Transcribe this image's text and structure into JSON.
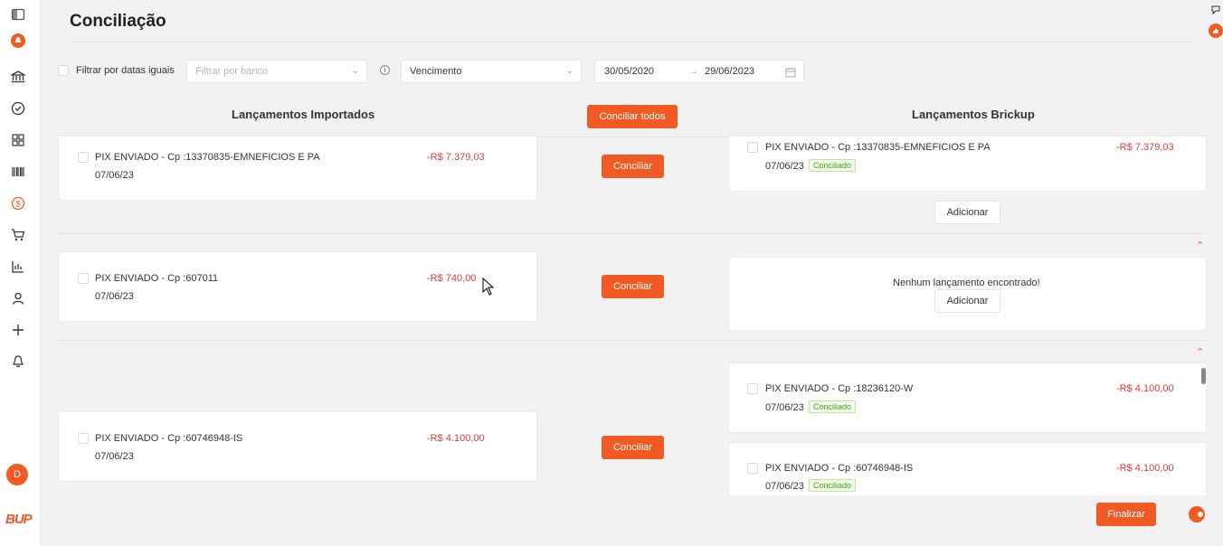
{
  "page": {
    "title": "Conciliação"
  },
  "sidebar": {
    "icons": [
      "sidebar-toggle-icon",
      "notification-badge-icon",
      "bank-icon",
      "check-circle-icon",
      "grid-icon",
      "barcode-icon",
      "dollar-circle-icon",
      "cart-icon",
      "chart-icon",
      "user-icon",
      "plus-icon",
      "bell-icon"
    ],
    "avatar": "D",
    "logo": "BUP"
  },
  "filters": {
    "same_dates_label": "Filtrar por datas iguais",
    "bank_placeholder": "Filtrar por banco",
    "date_type_value": "Vencimento",
    "date_from": "30/05/2020",
    "date_to": "29/06/2023"
  },
  "columns": {
    "imported_title": "Lançamentos Importados",
    "brickup_title": "Lançamentos Brickup",
    "conciliate_all": "Conciliar todos"
  },
  "rows": [
    {
      "imported": {
        "desc": "PIX ENVIADO - Cp :13370835-EMNEFICIOS E PA",
        "date": "07/06/23",
        "amount": "-R$ 7.379,03"
      },
      "action": "Conciliar",
      "brickup": [
        {
          "desc": "PIX ENVIADO - Cp :13370835-EMNEFICIOS E PA",
          "date": "07/06/23",
          "amount": "-R$ 7.379,03",
          "tag": "Conciliado"
        }
      ],
      "add_label": "Adicionar"
    },
    {
      "imported": {
        "desc": "PIX ENVIADO - Cp :607011",
        "date": "07/06/23",
        "amount": "-R$ 740,00"
      },
      "action": "Conciliar",
      "empty_message": "Nenhum lançamento encontrado!",
      "add_label": "Adicionar"
    },
    {
      "imported": {
        "desc": "PIX ENVIADO - Cp :60746948-IS",
        "date": "07/06/23",
        "amount": "-R$ 4.100,00"
      },
      "action": "Conciliar",
      "brickup": [
        {
          "desc": "PIX ENVIADO - Cp :18236120-W",
          "date": "07/06/23",
          "amount": "-R$ 4.100,00",
          "tag": "Conciliado"
        },
        {
          "desc": "PIX ENVIADO - Cp :60746948-IS",
          "date": "07/06/23",
          "amount": "-R$ 4.100,00",
          "tag": "Conciliado"
        }
      ]
    }
  ],
  "footer": {
    "finalize": "Finalizar"
  },
  "colors": {
    "accent": "#f15a22",
    "negative": "#e53935",
    "success": "#389e0d"
  }
}
